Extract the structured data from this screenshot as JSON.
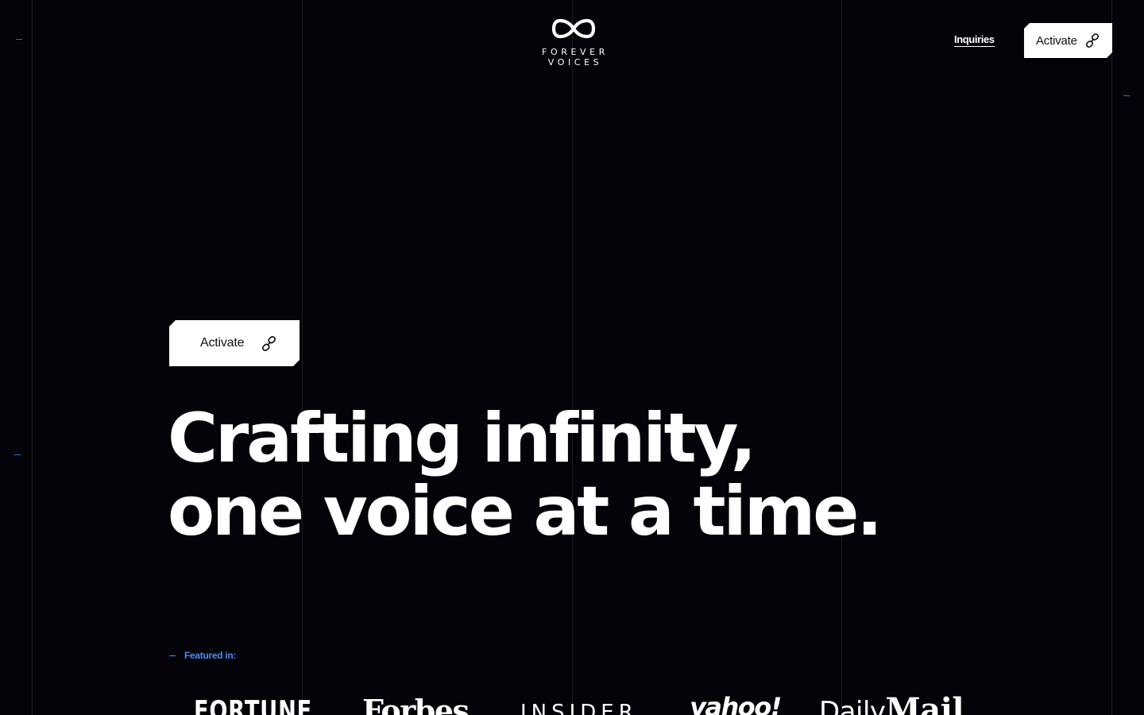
{
  "brand": {
    "line1": "FOREVER",
    "line2": "VOICES"
  },
  "nav": {
    "inquiries_label": "Inquiries",
    "activate_label": "Activate"
  },
  "hero": {
    "activate_label": "Activate",
    "headline_line1": "Crafting infinity,",
    "headline_line2": "one voice at a time."
  },
  "featured": {
    "label": "Featured in:",
    "outlets": {
      "fortune": "FORTUNE",
      "forbes": "Forbes",
      "insider": "INSIDER",
      "yahoo": "yahoo!",
      "dailymail_a": "Daily",
      "dailymail_b": "Mail"
    }
  },
  "colors": {
    "background": "#04030a",
    "accent": "#4a8cf0",
    "button_bg": "#ffffff",
    "grid_line": "#1c1b24"
  },
  "icons": {
    "logo": "infinity-icon",
    "button": "link-chain-icon"
  }
}
